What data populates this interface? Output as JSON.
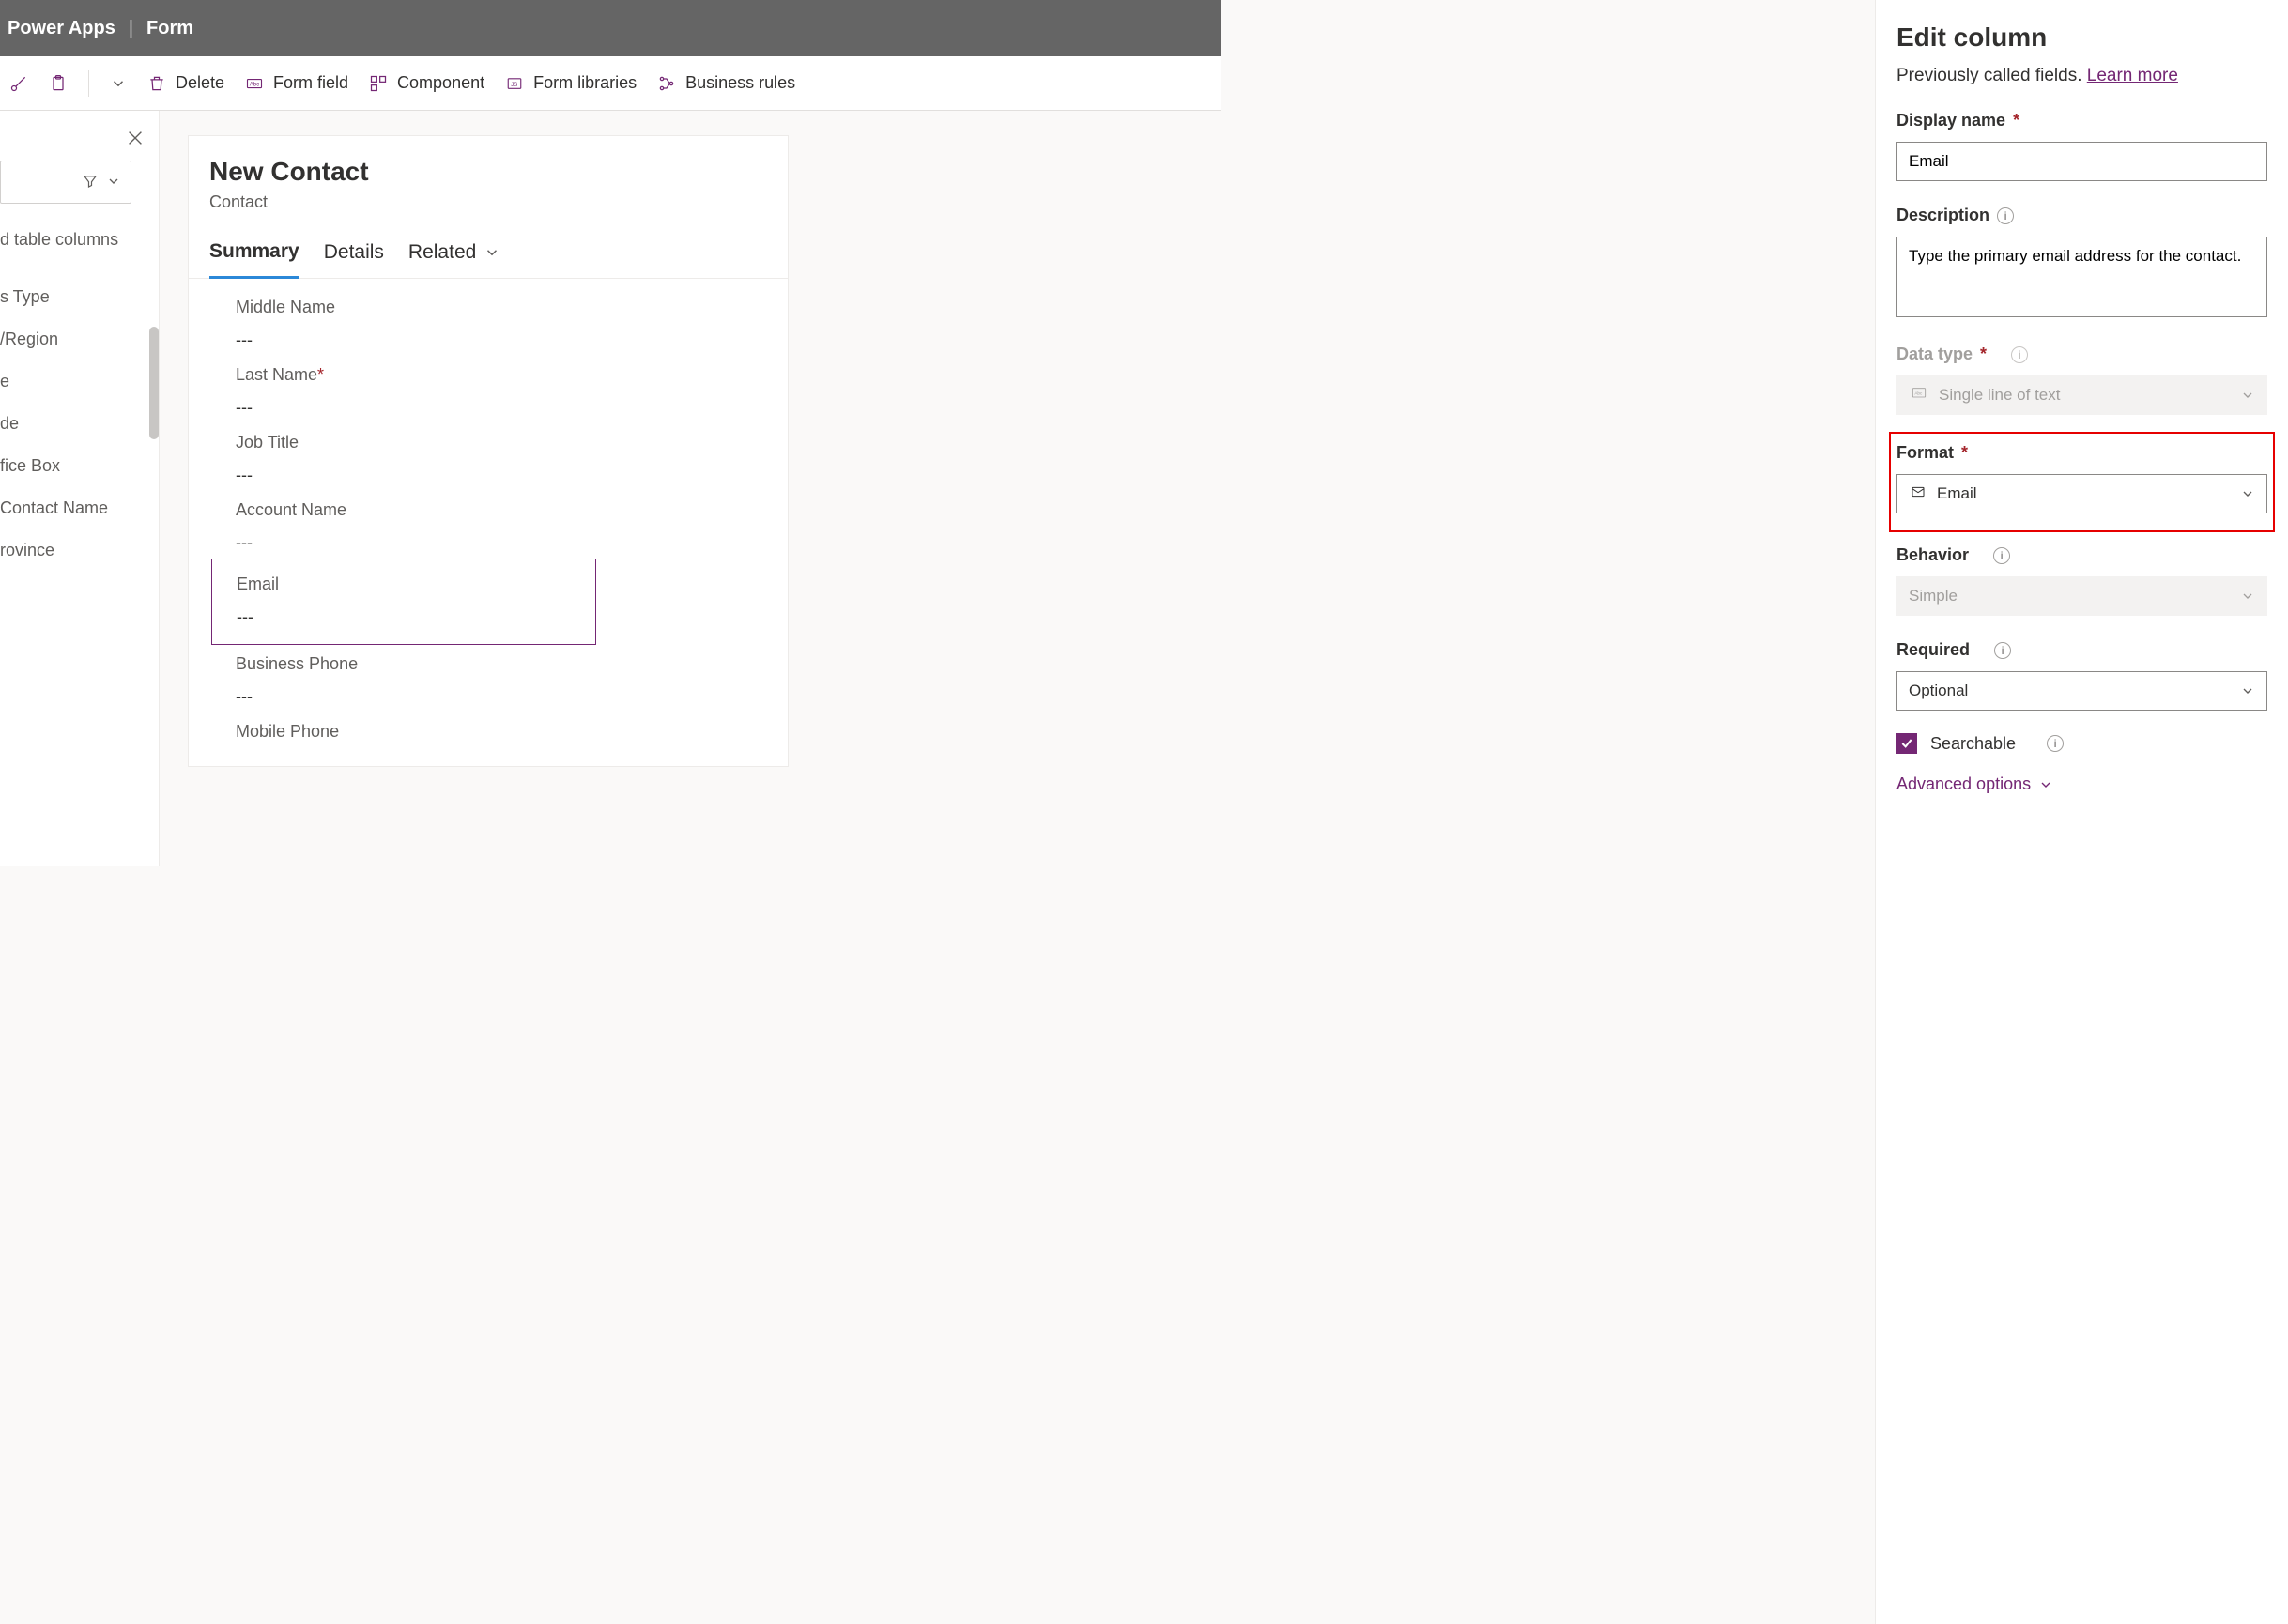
{
  "header": {
    "app": "Power Apps",
    "page": "Form"
  },
  "toolbar": {
    "delete": "Delete",
    "form_field": "Form field",
    "component": "Component",
    "form_libraries": "Form libraries",
    "business_rules": "Business rules"
  },
  "left_panel": {
    "section": "d table columns",
    "items": [
      "s Type",
      "/Region",
      "e",
      "de",
      "fice Box",
      "Contact Name",
      "rovince"
    ]
  },
  "form": {
    "title": "New Contact",
    "subtitle": "Contact",
    "tabs": {
      "summary": "Summary",
      "details": "Details",
      "related": "Related"
    },
    "fields": {
      "middle_name": {
        "label": "Middle Name",
        "value": "---"
      },
      "last_name": {
        "label": "Last Name",
        "value": "---",
        "required": true
      },
      "job_title": {
        "label": "Job Title",
        "value": "---"
      },
      "account_name": {
        "label": "Account Name",
        "value": "---"
      },
      "email": {
        "label": "Email",
        "value": "---"
      },
      "business_phone": {
        "label": "Business Phone",
        "value": "---"
      },
      "mobile_phone": {
        "label": "Mobile Phone",
        "value": ""
      }
    }
  },
  "panel": {
    "title": "Edit column",
    "sub_prefix": "Previously called fields. ",
    "learn_more": "Learn more",
    "display_name": {
      "label": "Display name",
      "value": "Email"
    },
    "description": {
      "label": "Description",
      "value": "Type the primary email address for the contact."
    },
    "data_type": {
      "label": "Data type",
      "value": "Single line of text"
    },
    "format": {
      "label": "Format",
      "value": "Email"
    },
    "behavior": {
      "label": "Behavior",
      "value": "Simple"
    },
    "required": {
      "label": "Required",
      "value": "Optional"
    },
    "searchable": "Searchable",
    "advanced": "Advanced options"
  }
}
